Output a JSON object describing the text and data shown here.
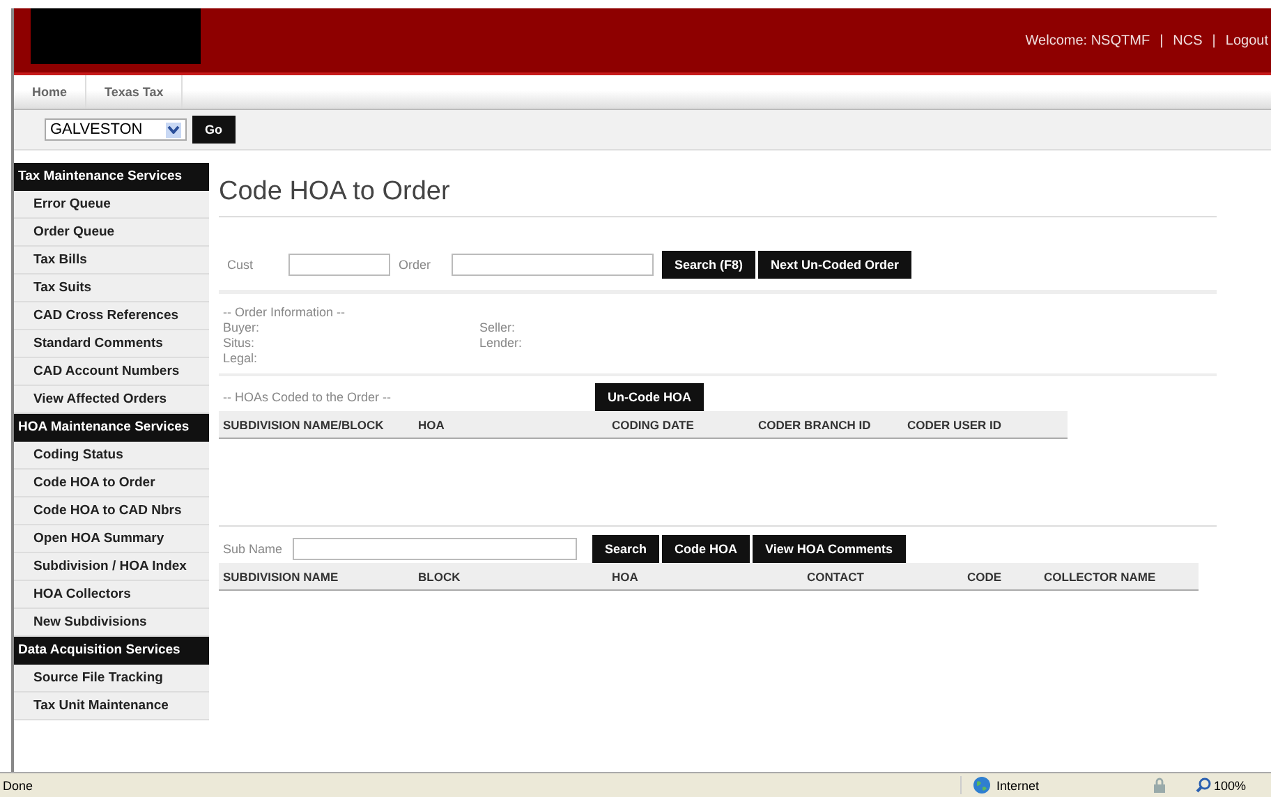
{
  "header": {
    "welcome": "Welcome: NSQTMF",
    "links": [
      "NCS",
      "Logout"
    ],
    "separator": "|"
  },
  "nav": {
    "tabs": [
      "Home",
      "Texas Tax"
    ]
  },
  "county": {
    "value": "GALVESTON",
    "button": "Go"
  },
  "sidebar": [
    {
      "heading": "Tax Maintenance Services",
      "items": [
        "Error Queue",
        "Order Queue",
        "Tax Bills",
        "Tax Suits",
        "CAD Cross References",
        "Standard Comments",
        "CAD Account Numbers",
        "View Affected Orders"
      ]
    },
    {
      "heading": "HOA Maintenance Services",
      "items": [
        "Coding Status",
        "Code HOA to Order",
        "Code HOA to CAD Nbrs",
        "Open HOA Summary",
        "Subdivision / HOA Index",
        "HOA Collectors",
        "New Subdivisions"
      ]
    },
    {
      "heading": "Data Acquisition Services",
      "items": [
        "Source File Tracking",
        "Tax Unit Maintenance"
      ]
    }
  ],
  "page_title": "Code HOA to Order",
  "search": {
    "cust_label": "Cust",
    "order_label": "Order",
    "buttons": [
      "Search (F8)",
      "Next Un-Coded Order"
    ]
  },
  "order_info": {
    "heading": "-- Order Information --",
    "left": [
      "Buyer:",
      "Situs:",
      "Legal:"
    ],
    "right": [
      "Seller:",
      "Lender:"
    ]
  },
  "coded": {
    "heading": "-- HOAs Coded to the Order --",
    "button": "Un-Code HOA",
    "columns": [
      "SUBDIVISION NAME/BLOCK",
      "HOA",
      "CODING DATE",
      "CODER BRANCH ID",
      "CODER USER ID"
    ]
  },
  "subdivision": {
    "label": "Sub Name",
    "buttons": [
      "Search",
      "Code HOA",
      "View HOA Comments"
    ],
    "columns": [
      "SUBDIVISION NAME",
      "BLOCK",
      "HOA",
      "CONTACT",
      "CODE",
      "COLLECTOR NAME"
    ]
  },
  "status_bar": {
    "text": "Done",
    "zone": "Internet",
    "zoom": "100%"
  }
}
